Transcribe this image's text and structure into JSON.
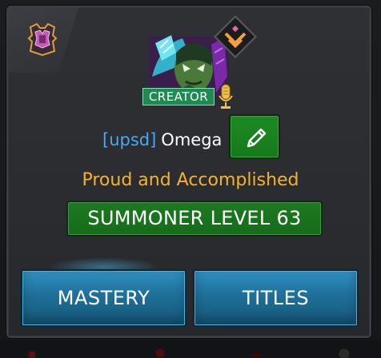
{
  "profile": {
    "alliance_tag": "[upsd]",
    "player_name": "Omega",
    "badge_label": "CREATOR",
    "title": "Proud and Accomplished",
    "level_label": "SUMMONER LEVEL 63"
  },
  "buttons": {
    "mastery": "MASTERY",
    "titles": "TITLES"
  },
  "icons": {
    "alliance": "alliance-crest-icon",
    "rank": "rank-diamond-icon",
    "edit": "pencil-icon",
    "microphone": "microphone-icon"
  },
  "colors": {
    "tag": "#4aa8f0",
    "title": "#f4b32a",
    "green_button": "#1d7a21",
    "blue_button": "#1f6f99",
    "creator_badge": "#1f8a54"
  }
}
